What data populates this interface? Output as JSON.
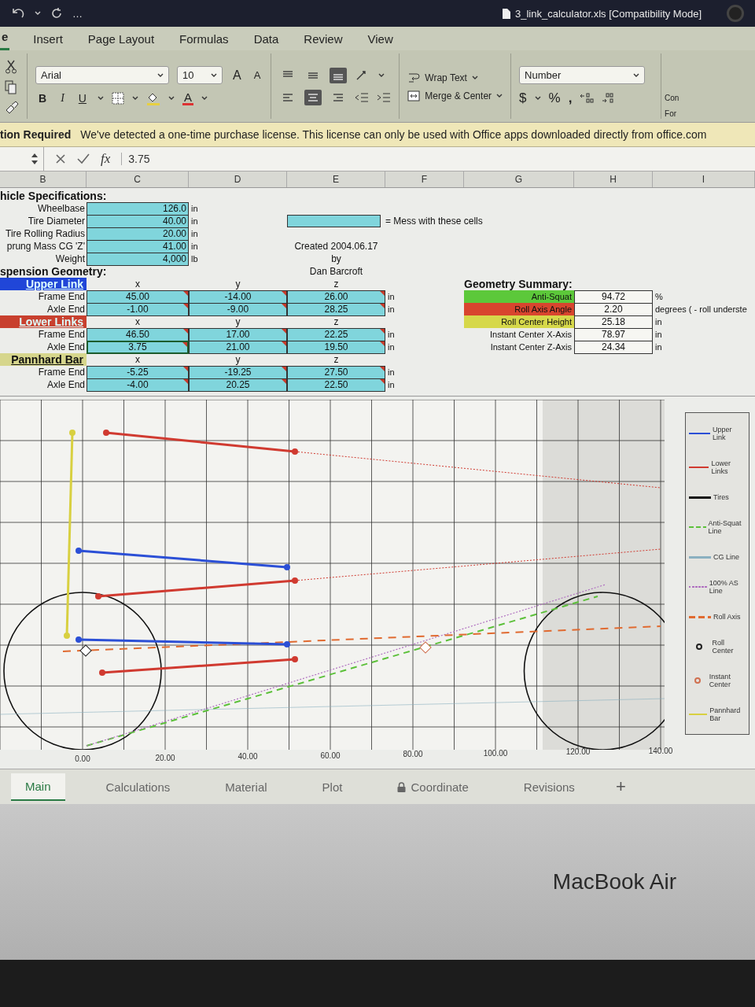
{
  "title_bar": {
    "more": "…",
    "file_title": "3_link_calculator.xls [Compatibility Mode]"
  },
  "tabs": [
    {
      "label": "e",
      "selected": true
    },
    {
      "label": "Insert",
      "selected": false
    },
    {
      "label": "Page Layout",
      "selected": false
    },
    {
      "label": "Formulas",
      "selected": false
    },
    {
      "label": "Data",
      "selected": false
    },
    {
      "label": "Review",
      "selected": false
    },
    {
      "label": "View",
      "selected": false
    }
  ],
  "ribbon": {
    "font_name": "Arial",
    "font_size": "10",
    "grow_font": "A",
    "shrink_font": "A",
    "format_buttons": [
      "B",
      "I",
      "U"
    ],
    "font_color": "A",
    "vertical_align": [
      {
        "kind": "top",
        "selected": false
      },
      {
        "kind": "middle",
        "selected": false
      },
      {
        "kind": "bottom",
        "selected": true
      }
    ],
    "horizontal_align": [
      {
        "kind": "left",
        "selected": false
      },
      {
        "kind": "center",
        "selected": true
      },
      {
        "kind": "right",
        "selected": false
      }
    ],
    "wrap_text": "Wrap Text",
    "merge_center": "Merge & Center",
    "number_format": "Number",
    "currency": "$",
    "percent": "%",
    "comma": ",",
    "cut_labels": [
      "Con",
      "For"
    ]
  },
  "message_bar": {
    "title": "tion Required",
    "text": "We've detected a one-time purchase license. This license can only be used with Office apps downloaded directly from office.com"
  },
  "formula_bar": {
    "fx": "fx",
    "value": "3.75"
  },
  "columns": [
    "B",
    "C",
    "D",
    "E",
    "F",
    "G",
    "H",
    "I"
  ],
  "vehicle_specs": {
    "title": "hicle Specifications:",
    "rows": [
      {
        "label": "Wheelbase",
        "value": "126.0",
        "unit": "in"
      },
      {
        "label": "Tire Diameter",
        "value": "40.00",
        "unit": "in"
      },
      {
        "label": "Tire Rolling Radius",
        "value": "20.00",
        "unit": "in"
      },
      {
        "label": "prung Mass CG 'Z'",
        "value": "41.00",
        "unit": "in"
      },
      {
        "label": "Weight",
        "value": "4,000",
        "unit": "lb"
      }
    ]
  },
  "input_key": {
    "text": "= Mess with these cells"
  },
  "credit": [
    "Created 2004.06.17",
    "by",
    "Dan Barcroft"
  ],
  "suspension": {
    "title": "spension Geometry:",
    "groups": [
      {
        "name": "Upper Link",
        "color": "#2046d8",
        "axes": [
          "x",
          "y",
          "z"
        ],
        "rows": [
          {
            "label": "Frame End",
            "unit": "in",
            "cells": [
              {
                "value": "45.00",
                "selected": false,
                "comment": true
              },
              {
                "value": "-14.00",
                "selected": false,
                "comment": true
              },
              {
                "value": "26.00",
                "selected": false,
                "comment": true
              }
            ]
          },
          {
            "label": "Axle End",
            "unit": "in",
            "cells": [
              {
                "value": "-1.00",
                "selected": false,
                "comment": true
              },
              {
                "value": "-9.00",
                "selected": false,
                "comment": true
              },
              {
                "value": "28.25",
                "selected": false,
                "comment": true
              }
            ]
          }
        ]
      },
      {
        "name": "Lower Links",
        "color": "#c8402e",
        "axes": [
          "x",
          "y",
          "z"
        ],
        "rows": [
          {
            "label": "Frame End",
            "unit": "in",
            "cells": [
              {
                "value": "46.50",
                "selected": false,
                "comment": true
              },
              {
                "value": "17.00",
                "selected": false,
                "comment": true
              },
              {
                "value": "22.25",
                "selected": false,
                "comment": true
              }
            ]
          },
          {
            "label": "Axle End",
            "unit": "in",
            "cells": [
              {
                "value": "3.75",
                "selected": true,
                "comment": true
              },
              {
                "value": "21.00",
                "selected": false,
                "comment": true
              },
              {
                "value": "19.50",
                "selected": false,
                "comment": true
              }
            ]
          }
        ]
      },
      {
        "name": "Pannhard Bar",
        "color": "#d6d68c",
        "axes": [
          "x",
          "y",
          "z"
        ],
        "rows": [
          {
            "label": "Frame End",
            "unit": "in",
            "cells": [
              {
                "value": "-5.25",
                "selected": false,
                "comment": true
              },
              {
                "value": "-19.25",
                "selected": false,
                "comment": true
              },
              {
                "value": "27.50",
                "selected": false,
                "comment": true
              }
            ]
          },
          {
            "label": "Axle End",
            "unit": "in",
            "cells": [
              {
                "value": "-4.00",
                "selected": false,
                "comment": true
              },
              {
                "value": "20.25",
                "selected": false,
                "comment": true
              },
              {
                "value": "22.50",
                "selected": false,
                "comment": true
              }
            ]
          }
        ]
      }
    ]
  },
  "summary": {
    "title": "Geometry Summary:",
    "rows": [
      {
        "label": "Anti-Squat",
        "color": "#5cc83a",
        "value": "94.72",
        "unit": "%"
      },
      {
        "label": "Roll Axis Angle",
        "color": "#d8452e",
        "value": "2.20",
        "unit": "degrees ( - roll underste"
      },
      {
        "label": "Roll Center Height",
        "color": "#d6d84a",
        "value": "25.18",
        "unit": "in"
      },
      {
        "label": "Instant Center X-Axis",
        "value": "78.97",
        "unit": "in"
      },
      {
        "label": "Instant Center Z-Axis",
        "value": "24.34",
        "unit": "in"
      }
    ]
  },
  "chart": {
    "legend": [
      {
        "label": "Upper Link",
        "color": "#2b4fd6",
        "kind": "line"
      },
      {
        "label": "Lower Links",
        "color": "#d03a30",
        "kind": "line"
      },
      {
        "label": "Tires",
        "color": "#111111",
        "kind": "line"
      },
      {
        "label": "Anti-Squat Line",
        "color": "#5cc03a",
        "kind": "dash"
      },
      {
        "label": "CG Line",
        "color": "#8ab0c0",
        "kind": "line"
      },
      {
        "label": "100% AS Line",
        "color": "#b070c0",
        "kind": "dot"
      },
      {
        "label": "Roll Axis",
        "color": "#e06a30",
        "kind": "dash"
      },
      {
        "label": "Roll Center",
        "color": "#222222",
        "kind": "marker"
      },
      {
        "label": "Instant Center",
        "color": "#d07050",
        "kind": "marker"
      },
      {
        "label": "Pannhard Bar",
        "color": "#d8d040",
        "kind": "line"
      }
    ],
    "x_labels": [
      "0.00",
      "20.00",
      "40.00",
      "60.00",
      "80.00",
      "100.00",
      "120.00",
      "140.00"
    ]
  },
  "sheet_tabs": [
    {
      "label": "Main",
      "selected": true,
      "locked": false
    },
    {
      "label": "Calculations",
      "selected": false,
      "locked": false
    },
    {
      "label": "Material",
      "selected": false,
      "locked": false
    },
    {
      "label": "Plot",
      "selected": false,
      "locked": false
    },
    {
      "label": "Coordinate",
      "selected": false,
      "locked": true
    },
    {
      "label": "Revisions",
      "selected": false,
      "locked": false
    }
  ],
  "add_sheet": "+",
  "device": {
    "label": "MacBook Air"
  }
}
